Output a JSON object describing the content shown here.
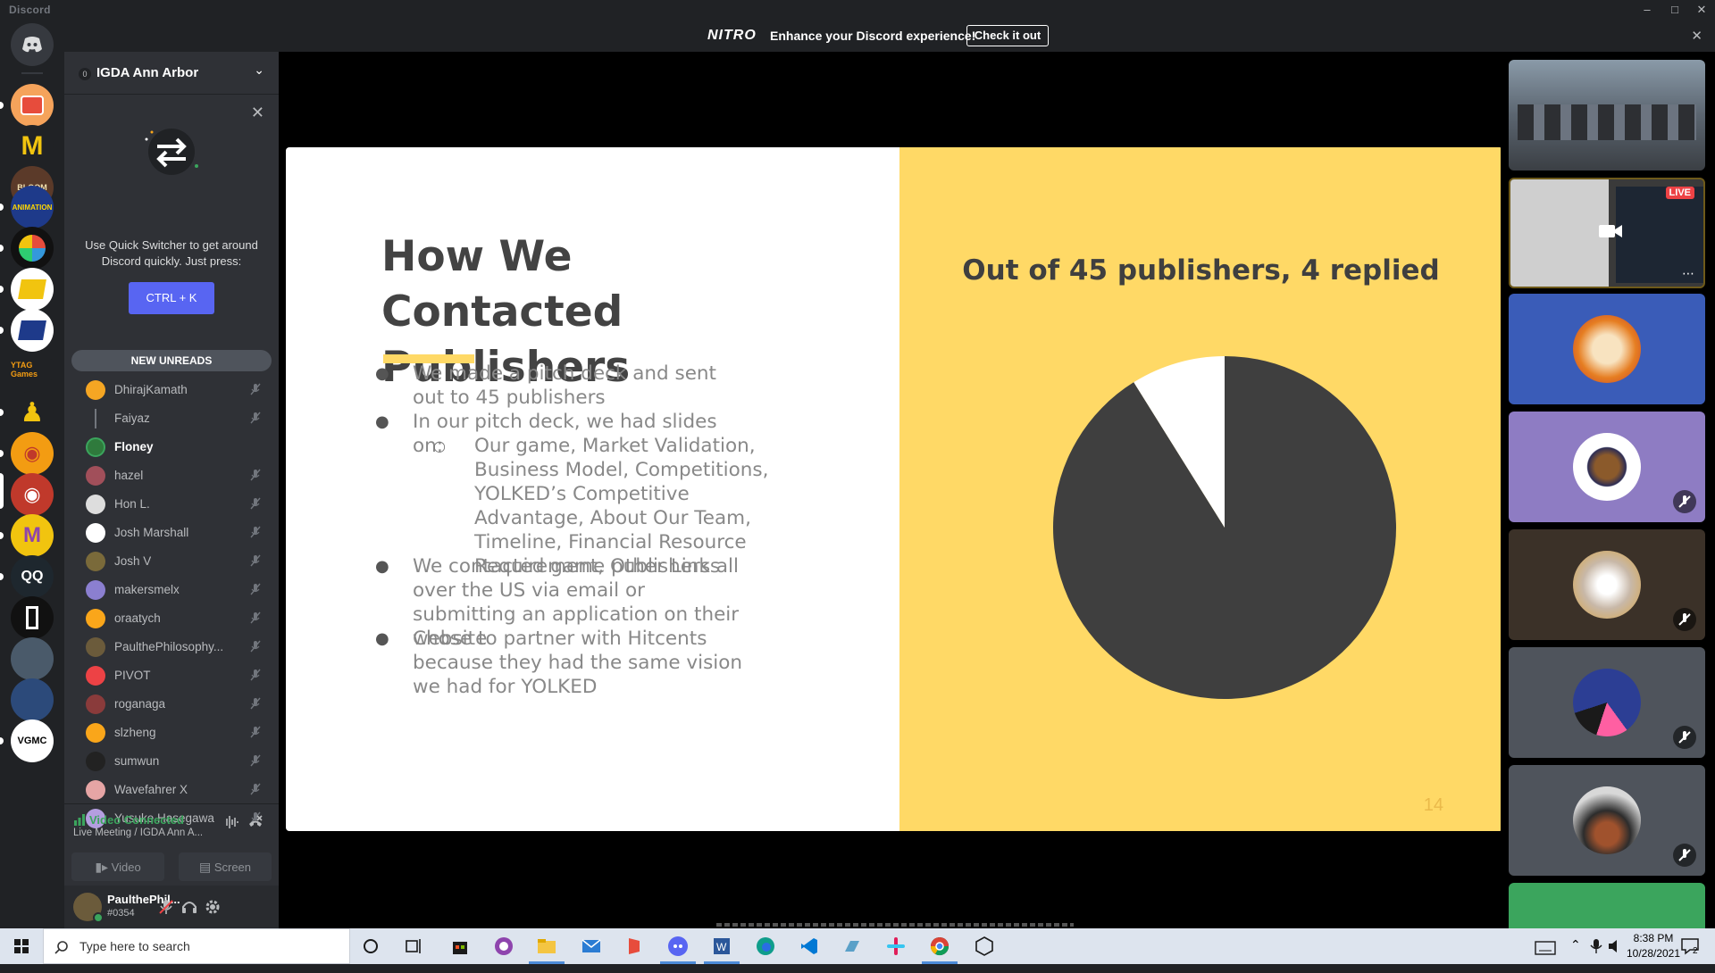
{
  "window": {
    "title": "Discord"
  },
  "nitro": {
    "logo": "NITRO",
    "text": "Enhance your Discord experience!",
    "button": "Check it out"
  },
  "server": {
    "name": "IGDA Ann Arbor",
    "level": "0"
  },
  "guild_labels": {
    "michigan_animation": "ANIMATION",
    "bloom": "BLOOM",
    "ytag": "YTAG Games",
    "vgmc": "VGMC"
  },
  "quick_switcher": {
    "text": "Use Quick Switcher to get around Discord quickly. Just press:",
    "shortcut": "CTRL + K"
  },
  "members": {
    "new_unreads": "NEW UNREADS",
    "list": [
      {
        "name": "DhirajKamath"
      },
      {
        "name": "Faiyaz"
      },
      {
        "name": "Floney"
      },
      {
        "name": "hazel"
      },
      {
        "name": "Hon L."
      },
      {
        "name": "Josh Marshall"
      },
      {
        "name": "Josh V"
      },
      {
        "name": "makersmelx"
      },
      {
        "name": "oraatych"
      },
      {
        "name": "PaulthePhilosophy..."
      },
      {
        "name": "PIVOT"
      },
      {
        "name": "roganaga"
      },
      {
        "name": "slzheng"
      },
      {
        "name": "sumwun"
      },
      {
        "name": "Wavefahrer X"
      },
      {
        "name": "Yusuke Hasegawa"
      }
    ]
  },
  "voice": {
    "status": "Video Connected",
    "channel": "Live Meeting / IGDA Ann A...",
    "video_label": "Video",
    "screen_label": "Screen"
  },
  "user": {
    "name": "PaulthePhil...",
    "tag": "#0354"
  },
  "slide": {
    "title": "How We Contacted Publishers",
    "bullets": [
      "We made a pitch deck and sent out to 45 publishers",
      "In our pitch deck, we had slides on:",
      "Our game, Market Validation, Business Model, Competitions, YOLKED’s Competitive Advantage, About Our Team, Timeline, Financial Resource Requirement, Other Links",
      "We contacted game publishers all over the US via email or submitting an application on their website",
      "Chose to partner with Hitcents because they had the same vision we had for YOLKED"
    ],
    "page_number": "14"
  },
  "chart_data": {
    "type": "pie",
    "title": "Out of 45 publishers, 4 replied",
    "values": [
      41,
      4
    ],
    "colors": [
      "#3f3f3f",
      "#ffffff"
    ]
  },
  "tiles": {
    "live_label": "LIVE"
  },
  "taskbar": {
    "search_placeholder": "Type here to search",
    "time": "8:38 PM",
    "date": "10/28/2021",
    "notifications": "2"
  }
}
